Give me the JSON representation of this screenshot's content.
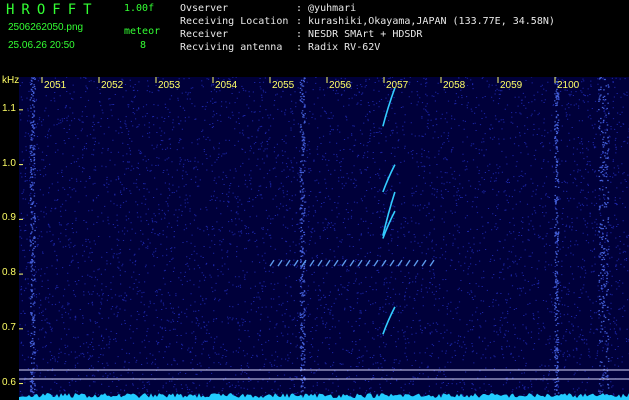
{
  "header": {
    "brand": "HROFFT",
    "version": "1.00f",
    "filename": "2506262050.png",
    "meteor_label": "meteor",
    "datetime": "25.06.26 20:50",
    "meteor_count": "8",
    "rows": [
      {
        "label": "Ovserver",
        "value": ": @yuhmari"
      },
      {
        "label": "Receiving Location",
        "value": ": kurashiki,Okayama,JAPAN (133.77E, 34.58N)"
      },
      {
        "label": "Receiver",
        "value": ": NESDR SMArt + HDSDR"
      },
      {
        "label": "Recviving antenna",
        "value": ": Radix RV-62V"
      }
    ]
  },
  "chart_data": {
    "type": "heatmap",
    "ylabel": "kHz",
    "x_ticks": [
      "2051",
      "2052",
      "2053",
      "2054",
      "2055",
      "2056",
      "2057",
      "2058",
      "2059",
      "2100"
    ],
    "y_ticks": [
      "1.1",
      "1.0",
      "0.9",
      "0.8",
      "0.7",
      "0.6"
    ],
    "ylim": [
      0.57,
      1.16
    ],
    "xlim_minutes": [
      0,
      10
    ],
    "meteors": [
      {
        "t": 6.05,
        "f_start": 1.07,
        "f_end": 1.14
      },
      {
        "t": 6.05,
        "f_start": 0.95,
        "f_end": 1.0
      },
      {
        "t": 6.05,
        "f_start": 0.865,
        "f_end": 0.915
      },
      {
        "t": 6.05,
        "f_start": 0.87,
        "f_end": 0.95
      },
      {
        "t": 6.05,
        "f_start": 0.69,
        "f_end": 0.74
      }
    ],
    "colors": {
      "background": "#00003a",
      "speckle": "#3344ff",
      "bright": "#33ccff",
      "tick": "#ffff66"
    }
  }
}
